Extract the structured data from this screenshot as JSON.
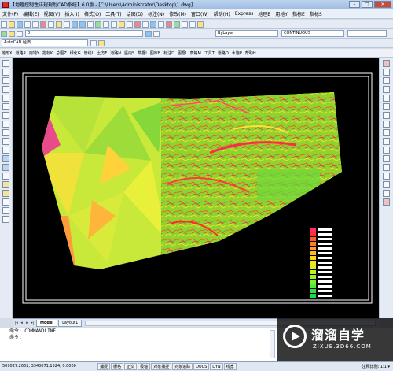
{
  "window": {
    "title": "【地理控制性详规规划CAD系统】6.0版 - [C:\\Users\\Administrator\\Desktop\\1.dwg]",
    "buttons": {
      "minimize": "–",
      "maximize": "□",
      "close": "✕"
    }
  },
  "menubar": {
    "items": [
      "文件(F)",
      "编辑(E)",
      "视图(V)",
      "插入(I)",
      "格式(O)",
      "工具(T)",
      "绘图(D)",
      "标注(N)",
      "修改(M)",
      "窗口(W)",
      "帮助(H)",
      "Express",
      "地理B",
      "用地Y",
      "指标E",
      "指标S"
    ]
  },
  "toolbar": {
    "style_combo": "AutoCAD 经典",
    "layer_combo": "0",
    "color_combo": "ByLayer",
    "linetype_combo": "CONTINUOUS"
  },
  "plugin_menu": {
    "items": [
      "地形X",
      "道路R",
      "用地Y",
      "指标K",
      "总图Z",
      "绿化G",
      "管线L",
      "土方F",
      "道路N",
      "竖向S",
      "数据I",
      "图库B",
      "标注D",
      "图框I",
      "表格M",
      "工具T",
      "道路O",
      "水施P",
      "帮助H"
    ]
  },
  "tabs": {
    "model": "Model",
    "layout1": "Layout1"
  },
  "command": {
    "line1": "命令: COMMANDLINE",
    "line2": "命令:"
  },
  "watermark": {
    "brand": "溜溜自学",
    "url": "ZIXUE.3D66.COM"
  },
  "status": {
    "coords": "509027.2662, 3340071.1524, 0.0000",
    "buttons": [
      "捕捉",
      "栅格",
      "正交",
      "极轴",
      "对象捕捉",
      "对象追踪",
      "DUCS",
      "DYN",
      "线宽"
    ],
    "scale": "注释比例: 1:1 ▾"
  },
  "legend": {
    "colors": [
      "#ff2b6a",
      "#ff3030",
      "#ff5a2a",
      "#ff7a28",
      "#ff9a24",
      "#ffb822",
      "#ffd21e",
      "#f4e61c",
      "#dcec20",
      "#bff024",
      "#9af02a",
      "#78ee32",
      "#52ea3a",
      "#2fe044",
      "#18d84c"
    ]
  },
  "colors": {
    "drawing_bg": "#000000",
    "frame": "#ffffff",
    "accent": "#c94a3b"
  }
}
